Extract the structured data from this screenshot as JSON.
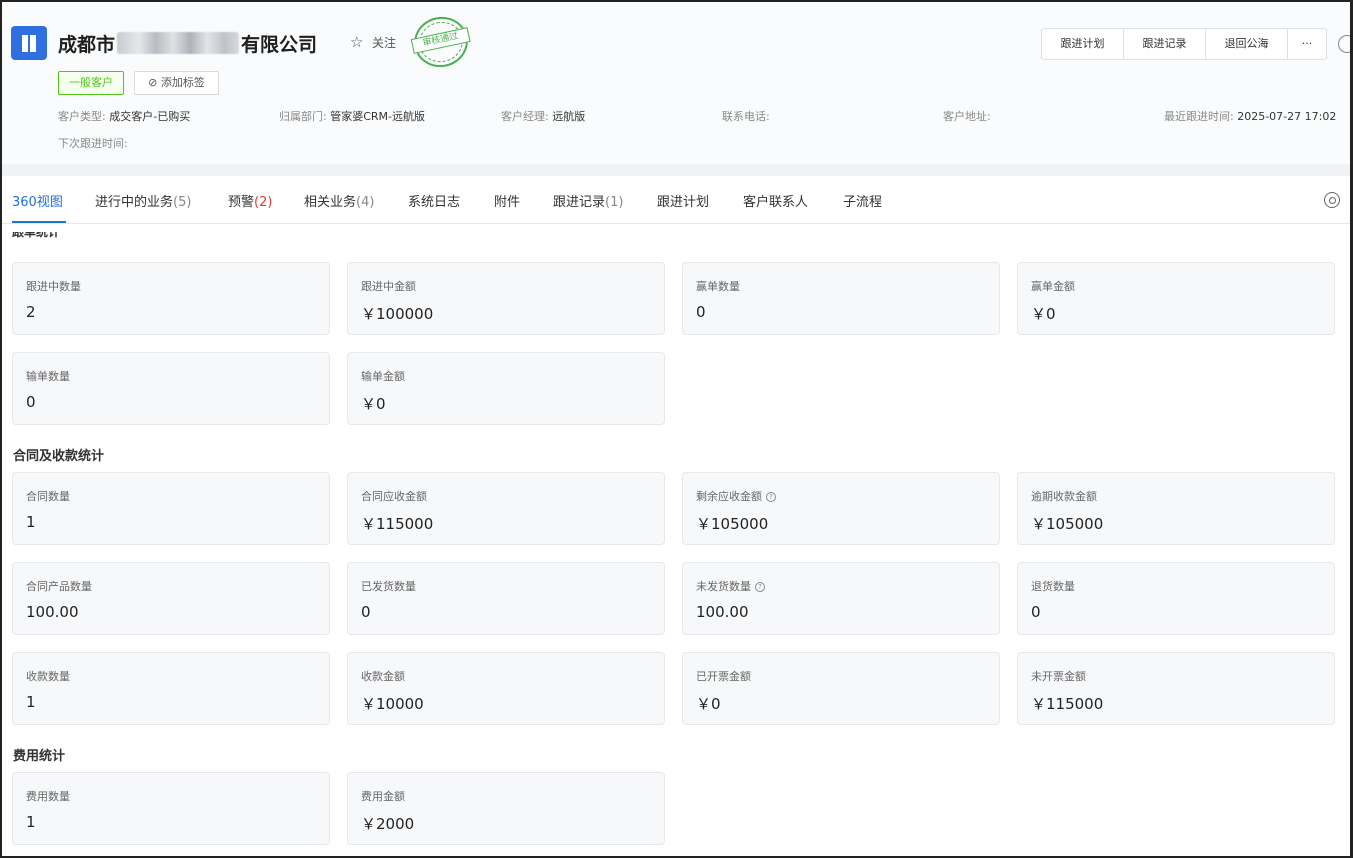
{
  "header": {
    "company_prefix": "成都市",
    "company_suffix": "有限公司",
    "follow_label": "关注",
    "stamp_text": "审核通过",
    "customer_tag": "一般客户",
    "add_tag": "添加标签",
    "info": [
      {
        "label": "客户类型:",
        "value": "成交客户-已购买"
      },
      {
        "label": "归属部门:",
        "value": "管家婆CRM-远航版"
      },
      {
        "label": "客户经理:",
        "value": "远航版"
      },
      {
        "label": "联系电话:",
        "value": ""
      },
      {
        "label": "客户地址:",
        "value": ""
      },
      {
        "label": "最近跟进时间:",
        "value": "2025-07-27 17:02"
      }
    ],
    "next_followup_label": "下次跟进时间:",
    "actions": [
      "跟进计划",
      "跟进记录",
      "退回公海",
      "···"
    ]
  },
  "tabs": [
    {
      "label": "360视图",
      "count": ""
    },
    {
      "label": "进行中的业务",
      "count": "(5)"
    },
    {
      "label": "预警",
      "count": "(2)"
    },
    {
      "label": "相关业务",
      "count": "(4)"
    },
    {
      "label": "系统日志",
      "count": ""
    },
    {
      "label": "附件",
      "count": ""
    },
    {
      "label": "跟进记录",
      "count": "(1)"
    },
    {
      "label": "跟进计划",
      "count": ""
    },
    {
      "label": "客户联系人",
      "count": ""
    },
    {
      "label": "子流程",
      "count": ""
    }
  ],
  "sections": {
    "deals_cut_title": "跟单统计",
    "deals": [
      {
        "label": "跟进中数量",
        "value": "2"
      },
      {
        "label": "跟进中金额",
        "value": "￥100000"
      },
      {
        "label": "赢单数量",
        "value": "0"
      },
      {
        "label": "赢单金额",
        "value": "￥0"
      },
      {
        "label": "输单数量",
        "value": "0"
      },
      {
        "label": "输单金额",
        "value": "￥0"
      }
    ],
    "contract_title": "合同及收款统计",
    "contract": [
      {
        "label": "合同数量",
        "value": "1"
      },
      {
        "label": "合同应收金额",
        "value": "￥115000"
      },
      {
        "label": "剩余应收金额",
        "value": "￥105000"
      },
      {
        "label": "逾期收款金额",
        "value": "￥105000"
      },
      {
        "label": "合同产品数量",
        "value": "100.00"
      },
      {
        "label": "已发货数量",
        "value": "0"
      },
      {
        "label": "未发货数量",
        "value": "100.00"
      },
      {
        "label": "退货数量",
        "value": "0"
      },
      {
        "label": "收款数量",
        "value": "1"
      },
      {
        "label": "收款金额",
        "value": "￥10000"
      },
      {
        "label": "已开票金额",
        "value": "￥0"
      },
      {
        "label": "未开票金额",
        "value": "￥115000"
      }
    ],
    "expense_title": "费用统计",
    "expense": [
      {
        "label": "费用数量",
        "value": "1"
      },
      {
        "label": "费用金额",
        "value": "￥2000"
      }
    ]
  },
  "colors": {
    "accent": "#1e6fe0",
    "tag_green": "#52c41a",
    "warning_red": "#e53935"
  },
  "icons": [
    "company-logo-icon",
    "star-icon",
    "approved-stamp-icon",
    "link-icon",
    "help-icon",
    "settings-icon"
  ]
}
